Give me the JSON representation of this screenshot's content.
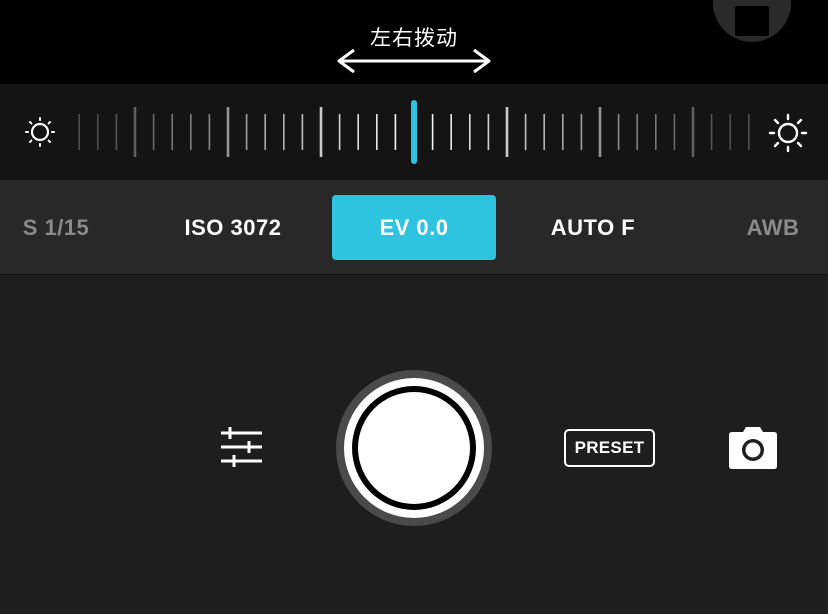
{
  "viewfinder": {
    "hint_text": "左右拨动",
    "stop_icon": "stop-icon"
  },
  "exposure_dial": {
    "left_icon": "sun-dim-icon",
    "right_icon": "sun-bright-icon",
    "indicator_color": "#2ec4e0"
  },
  "modes": [
    {
      "label": "S 1/15",
      "state": "dim"
    },
    {
      "label": "ISO 3072",
      "state": "normal"
    },
    {
      "label": "EV 0.0",
      "state": "active"
    },
    {
      "label": "AUTO F",
      "state": "normal"
    },
    {
      "label": "AWB",
      "state": "dim"
    }
  ],
  "controls": {
    "settings_icon": "sliders-icon",
    "shutter": "shutter-button",
    "preset_label": "PRESET",
    "camera_switch_icon": "camera-icon"
  },
  "colors": {
    "accent": "#2ec4e0",
    "background": "#1e1e1e",
    "mode_bar": "#282828"
  }
}
